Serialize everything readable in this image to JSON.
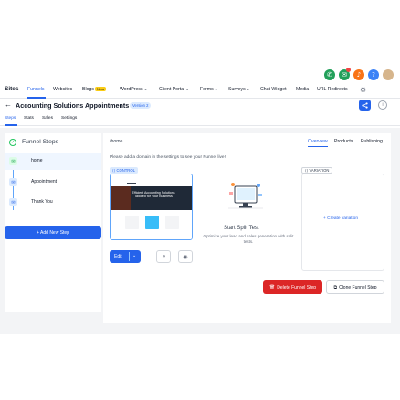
{
  "header_icons": [
    {
      "name": "phone-icon",
      "glyph": "✆",
      "color": "#22a05a"
    },
    {
      "name": "chat-icon",
      "glyph": "✉",
      "color": "#22a05a"
    },
    {
      "name": "notifications-icon",
      "glyph": "🔔",
      "color": "#f97316"
    },
    {
      "name": "help-icon",
      "glyph": "?",
      "color": "#3b82f6"
    },
    {
      "name": "avatar",
      "glyph": "",
      "color": "#d6b58c"
    }
  ],
  "nav": {
    "brand": "Sites",
    "items": [
      "Funnels",
      "Websites",
      "Blogs",
      "WordPress",
      "Client Portal",
      "Forms",
      "Surveys",
      "Chat Widget",
      "Media",
      "URL Redirects"
    ],
    "new_badge": "New"
  },
  "title": {
    "text": "Accounting Solutions Appointments",
    "version": "Version 2",
    "back_glyph": "←",
    "info_glyph": "i"
  },
  "subtabs": [
    "Steps",
    "Stats",
    "Sales",
    "Settings"
  ],
  "steps_panel": {
    "title": "Funnel Steps",
    "steps": [
      {
        "label": "home",
        "icon": "envelope-icon",
        "active": true
      },
      {
        "label": "Appointment",
        "icon": "envelope-icon",
        "active": false
      },
      {
        "label": "Thank You",
        "icon": "envelope-icon",
        "active": false
      }
    ],
    "add_button": "+ Add New Step"
  },
  "main": {
    "path": "/home",
    "tabs": [
      "Overview",
      "Products",
      "Publishing"
    ],
    "note": "Please add a domain in the settings to see your Funnel live!",
    "control_label": "CONTROL",
    "variation_label": "VARIATION",
    "preview_hero": "Efficient Accounting Solutions Tailored for Your Business",
    "split_title": "Start Split Test",
    "split_desc": "Optimize your lead and sales generation with split tests.",
    "create_variation": "+ Create variation",
    "edit_label": "Edit",
    "delete_label": "Delete Funnel Step",
    "clone_label": "Clone Funnel Step"
  },
  "colors": {
    "accent": "#2563eb",
    "danger": "#dc2626",
    "success": "#22c55e"
  }
}
